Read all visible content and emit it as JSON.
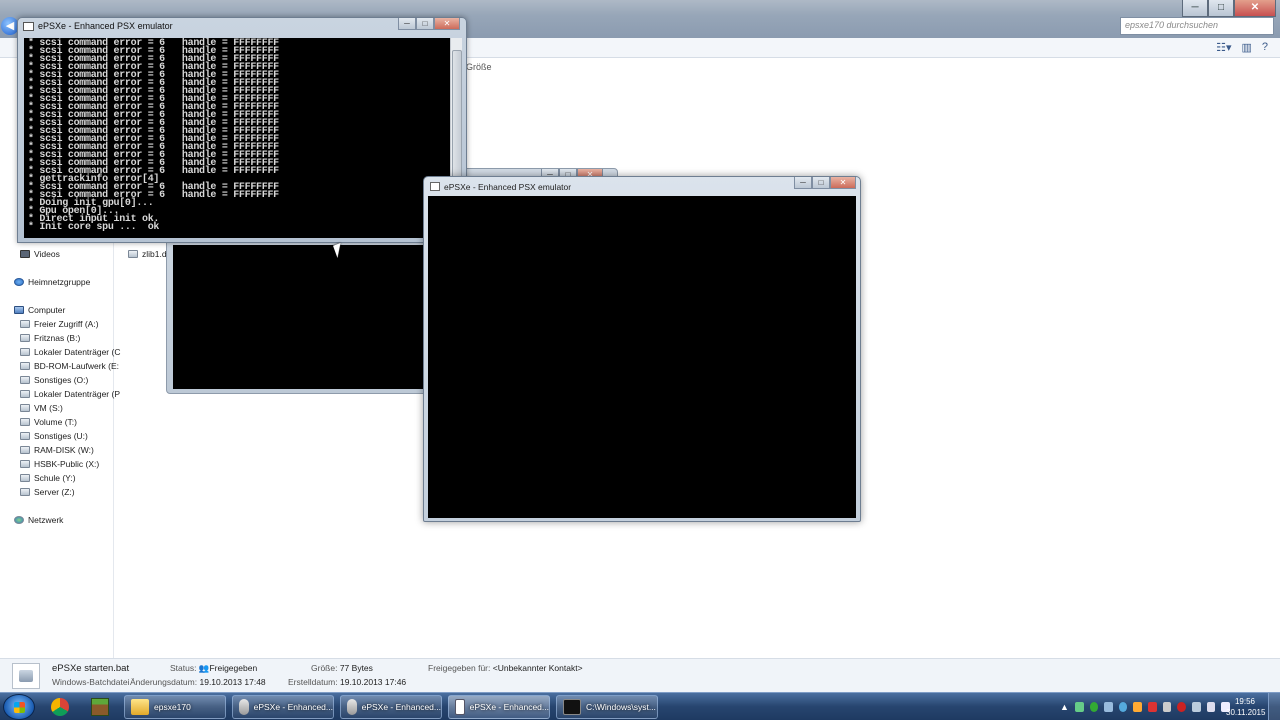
{
  "explorer": {
    "search_placeholder": "epsxe170 durchsuchen",
    "column_header": "Größe",
    "nav": {
      "videos": "Videos",
      "homegroup": "Heimnetzgruppe",
      "computer": "Computer",
      "drives": [
        "Freier Zugriff (A:)",
        "Fritznas (B:)",
        "Lokaler Datenträger (C",
        "BD-ROM-Laufwerk (E:",
        "Sonstiges (O:)",
        "Lokaler Datenträger (P",
        "VM (S:)",
        "Volume (T:)",
        "Sonstiges (U:)",
        "RAM-DISK (W:)",
        "HSBK-Public (X:)",
        "Schule (Y:)",
        "Server (Z:)"
      ],
      "network": "Netzwerk"
    },
    "file_item": "zlib1.dll",
    "details": {
      "filename": "ePSXe starten.bat",
      "filetype": "Windows-Batchdatei",
      "status_label": "Status:",
      "status_value": "Freigegeben",
      "modified_label": "Änderungsdatum:",
      "modified_value": "19.10.2013 17:48",
      "size_label": "Größe:",
      "size_value": "77 Bytes",
      "created_label": "Erstelldatum:",
      "created_value": "19.10.2013 17:46",
      "shared_label": "Freigegeben für:",
      "shared_value": "<Unbekannter Kontakt>"
    }
  },
  "console": {
    "title": "ePSXe - Enhanced PSX emulator",
    "lines": [
      "* scsi command error = 6   handle = FFFFFFFF",
      "* scsi command error = 6   handle = FFFFFFFF",
      "* scsi command error = 6   handle = FFFFFFFF",
      "* scsi command error = 6   handle = FFFFFFFF",
      "* scsi command error = 6   handle = FFFFFFFF",
      "* scsi command error = 6   handle = FFFFFFFF",
      "* scsi command error = 6   handle = FFFFFFFF",
      "* scsi command error = 6   handle = FFFFFFFF",
      "* scsi command error = 6   handle = FFFFFFFF",
      "* scsi command error = 6   handle = FFFFFFFF",
      "* scsi command error = 6   handle = FFFFFFFF",
      "* scsi command error = 6   handle = FFFFFFFF",
      "* scsi command error = 6   handle = FFFFFFFF",
      "* scsi command error = 6   handle = FFFFFFFF",
      "* scsi command error = 6   handle = FFFFFFFF",
      "* scsi command error = 6   handle = FFFFFFFF",
      "* scsi command error = 6   handle = FFFFFFFF",
      "* gettrackinfo error[4]",
      "* scsi command error = 6   handle = FFFFFFFF",
      "* scsi command error = 6   handle = FFFFFFFF",
      "* Doing init gpu[0]...",
      "* Gpu open[0]...",
      "* Direct input init ok.",
      "* Init core spu ...  ok"
    ]
  },
  "emulator_front": {
    "title": "ePSXe - Enhanced PSX emulator"
  },
  "taskbar": {
    "items": [
      {
        "label": "epsxe170"
      },
      {
        "label": "ePSXe - Enhanced..."
      },
      {
        "label": "ePSXe - Enhanced..."
      },
      {
        "label": "ePSXe - Enhanced..."
      },
      {
        "label": "C:\\Windows\\syst..."
      }
    ],
    "clock_time": "19:56",
    "clock_date": "30.11.2015"
  },
  "window_controls": {
    "minimize": "─",
    "maximize": "□",
    "close": "✕"
  }
}
